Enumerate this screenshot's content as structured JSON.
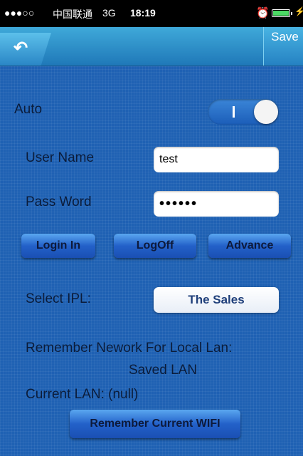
{
  "status_bar": {
    "signal": "●●●○○",
    "carrier": "中国联通",
    "network": "3G",
    "time": "18:19"
  },
  "nav": {
    "back_icon": "undo-arrow-icon",
    "save_label": "Save"
  },
  "form": {
    "auto_label": "Auto",
    "auto_on": true,
    "user_name_label": "User Name",
    "user_name_value": "test",
    "pass_word_label": "Pass Word",
    "pass_word_value": "••••••"
  },
  "buttons": {
    "login": "Login In",
    "logoff": "LogOff",
    "advance": "Advance"
  },
  "ipl": {
    "label": "Select IPL:",
    "value": "The Sales"
  },
  "network": {
    "remember_label": "Remember Nework For Local Lan:",
    "saved_lan": "Saved LAN",
    "current_lan": "Current LAN: (null)",
    "remember_button": "Remember Current WIFI"
  },
  "colors": {
    "background": "#1f61b3",
    "nav": "#3fa9d9"
  }
}
